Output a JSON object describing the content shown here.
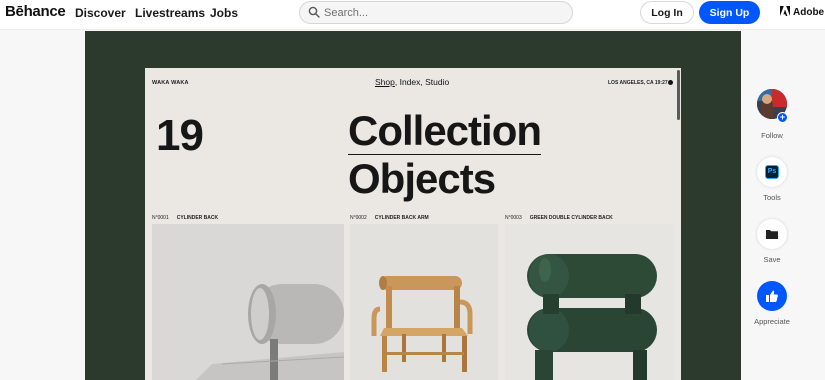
{
  "header": {
    "logo": "Bēhance",
    "nav": [
      "Discover",
      "Livestreams",
      "Jobs"
    ],
    "search_placeholder": "Search...",
    "login_label": "Log In",
    "signup_label": "Sign Up",
    "adobe_label": "Adobe"
  },
  "project": {
    "site_brand": "WAKA WAKA",
    "site_nav_shop": "Shop",
    "site_nav_rest": ", Index, Studio",
    "site_location": "LOS ANGELES, CA 19:27",
    "number": "19",
    "title_line1": "Collection",
    "title_line2": "Objects",
    "items": [
      {
        "num": "N°0001",
        "name": "CYLINDER BACK"
      },
      {
        "num": "N°0002",
        "name": "CYLINDER BACK ARM"
      },
      {
        "num": "N°0003",
        "name": "GREEN DOUBLE CYLINDER BACK"
      }
    ]
  },
  "sidebar": {
    "follow_label": "Follow",
    "tools_label": "Tools",
    "tools_icon_text": "Ps",
    "save_label": "Save",
    "appreciate_label": "Appreciate"
  },
  "colors": {
    "brand_blue": "#0057ff",
    "project_bg": "#2c3a2d",
    "page_bg": "#ebe8e4"
  }
}
